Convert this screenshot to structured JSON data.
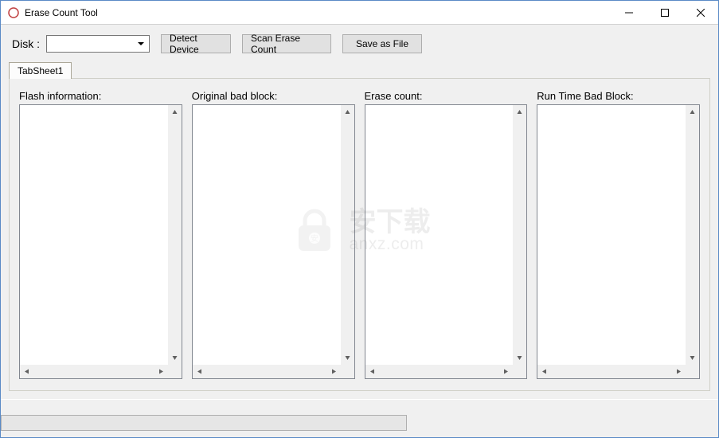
{
  "window": {
    "title": "Erase Count Tool"
  },
  "toolbar": {
    "disk_label": "Disk :",
    "disk_value": "",
    "detect_label": "Detect Device",
    "scan_label": "Scan Erase Count",
    "save_label": "Save as File"
  },
  "tabs": [
    {
      "label": "TabSheet1"
    }
  ],
  "panels": {
    "flash_info": {
      "label": "Flash information:",
      "content": ""
    },
    "orig_bad_block": {
      "label": "Original bad block:",
      "content": ""
    },
    "erase_count": {
      "label": "Erase count:",
      "content": ""
    },
    "runtime_bad_block": {
      "label": "Run Time Bad Block:",
      "content": ""
    }
  },
  "watermark": {
    "line1": "安下载",
    "line2": "anxz.com"
  },
  "progress": {
    "value": 0
  }
}
